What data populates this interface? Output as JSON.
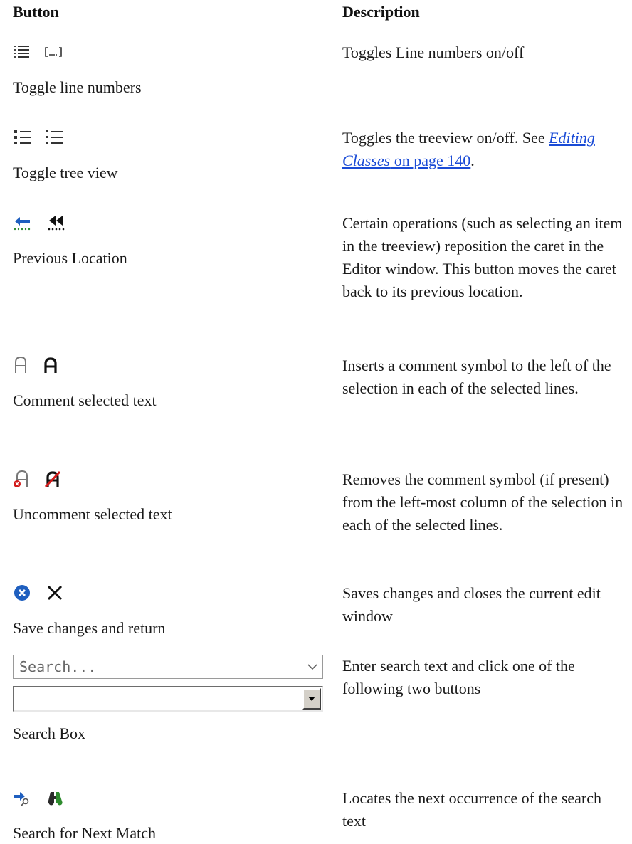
{
  "header": {
    "button": "Button",
    "description": "Description"
  },
  "rows": [
    {
      "icons": [
        "line-numbers-icon",
        "bracket-ellipsis-icon"
      ],
      "label": "Toggle line numbers",
      "description": "Toggles Line numbers on/off"
    },
    {
      "icons": [
        "tree-view-icon",
        "list-view-icon"
      ],
      "label": "Toggle tree view",
      "description_prefix": "Toggles the treeview on/off. See ",
      "link_italic": "Editing Classes",
      "link_rest": " on page 140",
      "description_suffix": "."
    },
    {
      "icons": [
        "back-arrow-icon",
        "double-chevron-left-icon"
      ],
      "label": "Previous Location",
      "description": "Certain operations (such as selecting an item in the treeview) reposition the caret in the Editor window. This button moves the caret back to its previous location."
    },
    {
      "icons": [
        "comment-outline-icon",
        "comment-bold-icon"
      ],
      "label": "Comment selected text",
      "description": "Inserts a comment symbol to the left of the selection in each of the selected lines."
    },
    {
      "icons": [
        "uncomment-outline-icon",
        "uncomment-bold-icon"
      ],
      "label": "Uncomment selected text",
      "description": "Removes the comment symbol (if present) from the left-most column of the selection in each of the selected lines."
    },
    {
      "icons": [
        "close-circle-icon",
        "close-x-icon"
      ],
      "label": "Save changes and return",
      "description": "Saves changes and closes the current edit window"
    },
    {
      "search_placeholder": "Search...",
      "label": "Search Box",
      "description": "Enter search text and click one of the following two buttons"
    },
    {
      "icons": [
        "find-next-icon",
        "binoculars-icon"
      ],
      "label": "Search for Next Match",
      "description": "Locates the next occurrence of the search text"
    }
  ],
  "colors": {
    "link": "#1a4bd6",
    "accent_blue": "#1f5fbf",
    "accent_red": "#d21a1a",
    "accent_green": "#2e8b2e"
  }
}
